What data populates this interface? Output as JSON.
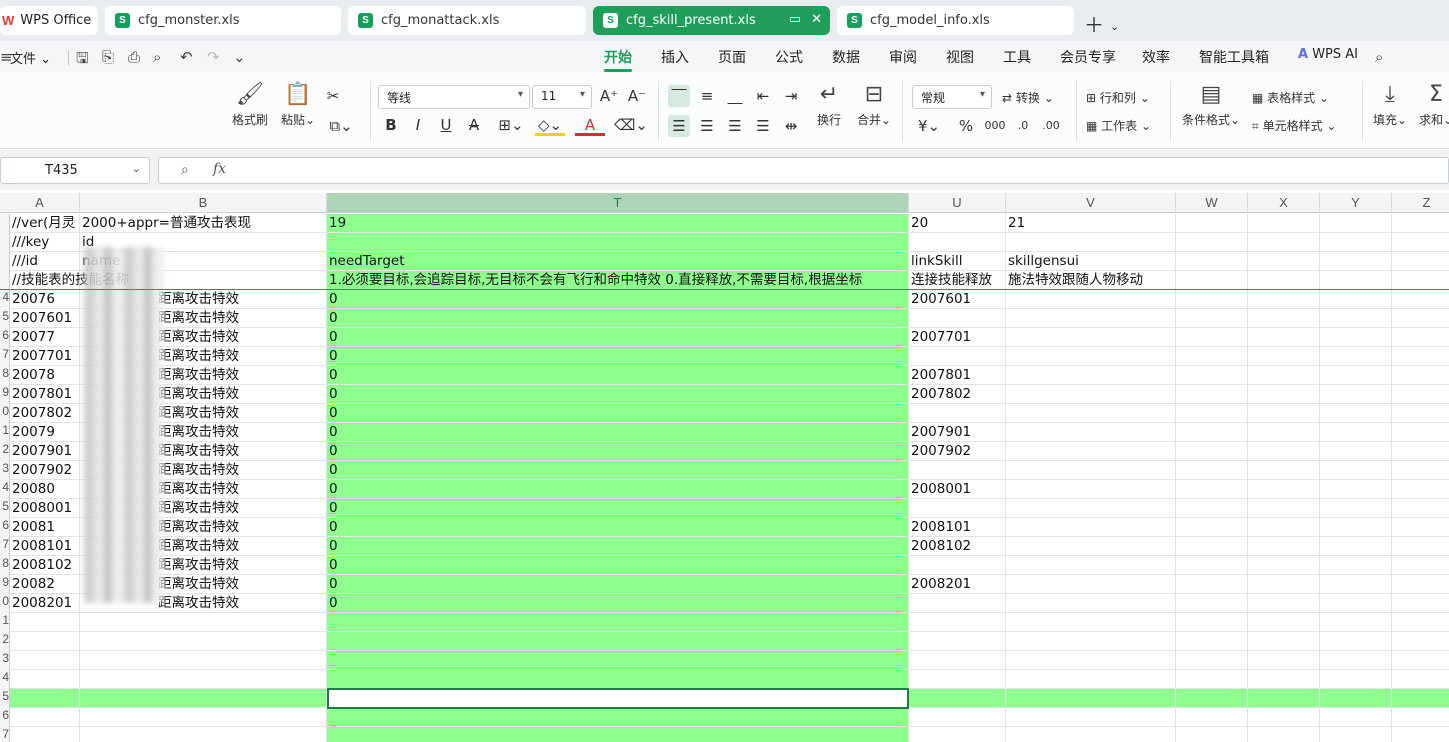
{
  "tabs": {
    "home": "WPS Office",
    "files": [
      {
        "label": "cfg_monster.xls",
        "active": false
      },
      {
        "label": "cfg_monattack.xls",
        "active": false
      },
      {
        "label": "cfg_skill_present.xls",
        "active": true
      },
      {
        "label": "cfg_model_info.xls",
        "active": false
      }
    ]
  },
  "menubar": {
    "file": "文件",
    "items": [
      "开始",
      "插入",
      "页面",
      "公式",
      "数据",
      "审阅",
      "视图",
      "工具",
      "会员专享",
      "效率",
      "智能工具箱"
    ],
    "active_index": 0,
    "ai": "WPS AI"
  },
  "ribbon": {
    "format_painter": "格式刷",
    "paste": "粘贴",
    "font_name": "等线",
    "font_size": "11",
    "wrap": "换行",
    "merge": "合并",
    "number_format": "常规",
    "convert": "转换",
    "rows_cols": "行和列",
    "worksheet": "工作表",
    "cond_format": "条件格式",
    "table_style": "表格样式",
    "cell_style": "单元格样式",
    "fill": "填充",
    "sum": "求和"
  },
  "formula_bar": {
    "cell_ref": "T435",
    "formula": ""
  },
  "grid": {
    "columns": [
      "A",
      "B",
      "T",
      "U",
      "V",
      "W",
      "X",
      "Y",
      "Z"
    ],
    "selected_column": "T",
    "row_numbers": [
      "",
      "",
      "",
      "",
      "4",
      "5",
      "6",
      "7",
      "8",
      "9",
      "0",
      "1",
      "2",
      "3",
      "4",
      "5",
      "6",
      "7",
      "8",
      "9",
      "0",
      "1",
      "2",
      "3",
      "4",
      "5",
      "6",
      "7"
    ],
    "header_rows": [
      {
        "A": "//ver(月灵",
        "B": "2000+appr=普通攻击表现",
        "T": "19",
        "U": "20",
        "V": "21"
      },
      {
        "A": "///key",
        "B": "id",
        "T": "",
        "U": "",
        "V": ""
      },
      {
        "A": "///id",
        "B": "name",
        "T": "needTarget",
        "U": "linkSkill",
        "V": "skillgensui"
      },
      {
        "A": "//技能表的技能名称",
        "B": "",
        "T": "1.必须要目标,会追踪目标,无目标不会有飞行和命中特效 0.直接释放,不需要目标,根据坐标",
        "U": "连接技能释放",
        "V": "施法特效跟随人物移动"
      }
    ],
    "data_rows": [
      {
        "A": "20076",
        "B": "距离攻击特效",
        "T": "0",
        "U": "2007601"
      },
      {
        "A": "2007601",
        "B": "距离攻击特效",
        "T": "0",
        "U": ""
      },
      {
        "A": "20077",
        "B": "距离攻击特效",
        "T": "0",
        "U": "2007701"
      },
      {
        "A": "2007701",
        "B": "距离攻击特效",
        "T": "0",
        "U": ""
      },
      {
        "A": "20078",
        "B": "距离攻击特效",
        "T": "0",
        "U": "2007801"
      },
      {
        "A": "2007801",
        "B": "距离攻击特效",
        "T": "0",
        "U": "2007802"
      },
      {
        "A": "2007802",
        "B": "距离攻击特效",
        "T": "0",
        "U": ""
      },
      {
        "A": "20079",
        "B": "距离攻击特效",
        "T": "0",
        "U": "2007901"
      },
      {
        "A": "2007901",
        "B": "距离攻击特效",
        "T": "0",
        "U": "2007902"
      },
      {
        "A": "2007902",
        "B": "距离攻击特效",
        "T": "0",
        "U": ""
      },
      {
        "A": "20080",
        "B": "距离攻击特效",
        "T": "0",
        "U": "2008001"
      },
      {
        "A": "2008001",
        "B": "距离攻击特效",
        "T": "0",
        "U": ""
      },
      {
        "A": "20081",
        "B": "距离攻击特效",
        "T": "0",
        "U": "2008101"
      },
      {
        "A": "2008101",
        "B": "距离攻击特效",
        "T": "0",
        "U": "2008102"
      },
      {
        "A": "2008102",
        "B": "距离攻击特效",
        "T": "0",
        "U": ""
      },
      {
        "A": "20082",
        "B": "距离攻击特效",
        "T": "0",
        "U": "2008201"
      },
      {
        "A": "2008201",
        "B": "距离攻击特效",
        "T": "0",
        "U": ""
      }
    ],
    "highlight_color": "#8efe8e",
    "accent_color": "#1f9e5a"
  }
}
